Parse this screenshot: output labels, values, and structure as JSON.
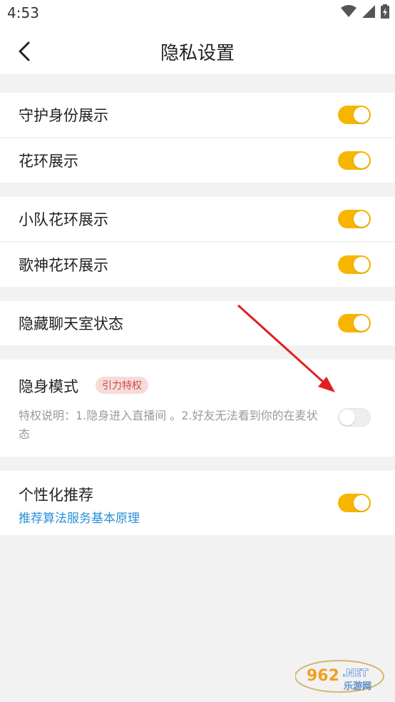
{
  "status_bar": {
    "time": "4:53"
  },
  "header": {
    "title": "隐私设置"
  },
  "rows": [
    {
      "label": "守护身份展示",
      "on": true
    },
    {
      "label": "花环展示",
      "on": true
    },
    {
      "label": "小队花环展示",
      "on": true
    },
    {
      "label": "歌神花环展示",
      "on": true
    },
    {
      "label": "隐藏聊天室状态",
      "on": true
    }
  ],
  "stealth": {
    "label": "隐身模式",
    "badge": "引力特权",
    "desc": "特权说明：1.隐身进入直播间 。2.好友无法看到你的在麦状态",
    "on": false
  },
  "personalize": {
    "label": "个性化推荐",
    "link": "推荐算法服务基本原理",
    "on": true
  },
  "watermark": {
    "num": "962",
    "suffix": ".NET",
    "sub": "乐游网"
  },
  "colors": {
    "accent": "#f7b500",
    "link": "#2a8fd8",
    "arrow": "#e02020"
  }
}
